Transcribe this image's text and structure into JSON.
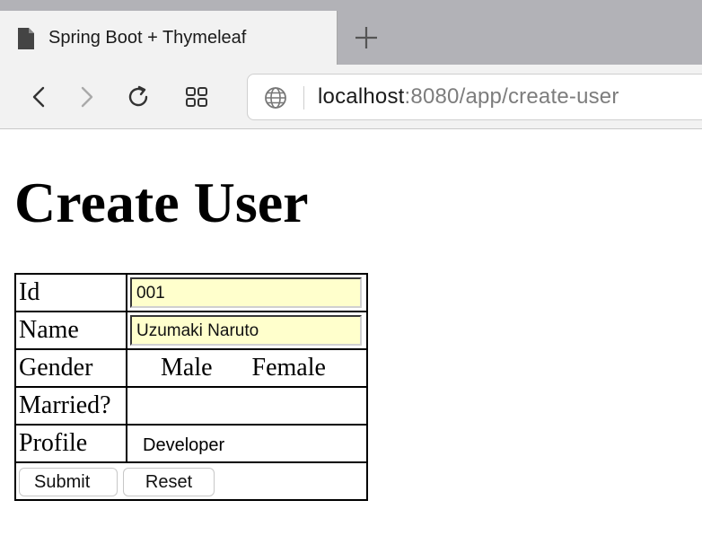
{
  "browser": {
    "tab_title": "Spring Boot + Thymeleaf",
    "url_host": "localhost",
    "url_rest": ":8080/app/create-user",
    "icons": [
      "document-icon",
      "new-tab-icon",
      "back-icon",
      "forward-icon",
      "reload-icon",
      "tabs-overview-icon",
      "globe-icon"
    ]
  },
  "page": {
    "title": "Create User"
  },
  "form": {
    "id_label": "Id",
    "id_value": "001",
    "name_label": "Name",
    "name_value": "Uzumaki Naruto",
    "gender_label": "Gender",
    "gender_options": [
      "Male",
      "Female"
    ],
    "married_label": "Married?",
    "profile_label": "Profile",
    "profile_value": "Developer",
    "submit_label": "Submit",
    "reset_label": "Reset",
    "input_bg_color": "#ffffcc"
  }
}
